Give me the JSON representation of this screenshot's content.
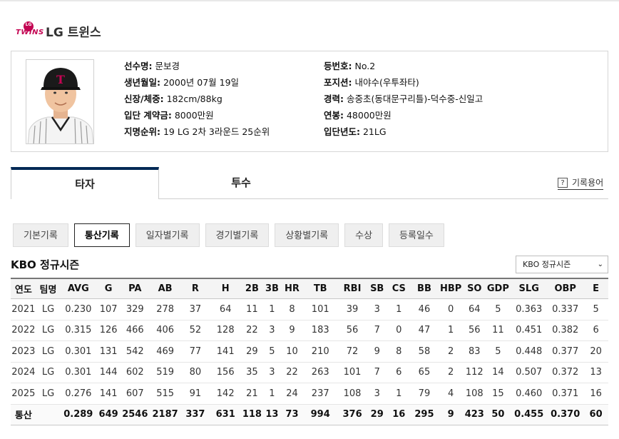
{
  "team": {
    "name": "LG 트윈스",
    "logo_text": "TWINS",
    "logo_mark": "LG"
  },
  "player": {
    "labels": {
      "name": "선수명:",
      "birth": "생년월일:",
      "body": "신장/체중:",
      "signing": "입단 계약금:",
      "draft": "지명순위:",
      "number": "등번호:",
      "position": "포지션:",
      "career": "경력:",
      "salary": "연봉:",
      "entry_year": "입단년도:"
    },
    "values": {
      "name": "문보경",
      "birth": "2000년 07월 19일",
      "body": "182cm/88kg",
      "signing": "8000만원",
      "draft": "19 LG 2차 3라운드 25순위",
      "number": "No.2",
      "position": "내야수(우투좌타)",
      "career": "송중초(동대문구리틀)-덕수중-신일고",
      "salary": "48000만원",
      "entry_year": "21LG"
    }
  },
  "tabs": [
    {
      "label": "타자",
      "active": true
    },
    {
      "label": "투수",
      "active": false
    }
  ],
  "glossary_label": "기록용어",
  "subtabs": [
    {
      "label": "기본기록",
      "active": false
    },
    {
      "label": "통산기록",
      "active": true
    },
    {
      "label": "일자별기록",
      "active": false
    },
    {
      "label": "경기별기록",
      "active": false
    },
    {
      "label": "상황별기록",
      "active": false
    },
    {
      "label": "수상",
      "active": false
    },
    {
      "label": "등록일수",
      "active": false
    }
  ],
  "section_title": "KBO 정규시즌",
  "season_select": "KBO 정규시즌",
  "stats": {
    "headers": [
      "연도",
      "팀명",
      "AVG",
      "G",
      "PA",
      "AB",
      "R",
      "H",
      "2B",
      "3B",
      "HR",
      "TB",
      "RBI",
      "SB",
      "CS",
      "BB",
      "HBP",
      "SO",
      "GDP",
      "SLG",
      "OBP",
      "E"
    ],
    "rows": [
      [
        "2021",
        "LG",
        "0.230",
        "107",
        "329",
        "278",
        "37",
        "64",
        "11",
        "1",
        "8",
        "101",
        "39",
        "3",
        "1",
        "46",
        "0",
        "64",
        "5",
        "0.363",
        "0.337",
        "5"
      ],
      [
        "2022",
        "LG",
        "0.315",
        "126",
        "466",
        "406",
        "52",
        "128",
        "22",
        "3",
        "9",
        "183",
        "56",
        "7",
        "0",
        "47",
        "1",
        "56",
        "11",
        "0.451",
        "0.382",
        "6"
      ],
      [
        "2023",
        "LG",
        "0.301",
        "131",
        "542",
        "469",
        "77",
        "141",
        "29",
        "5",
        "10",
        "210",
        "72",
        "9",
        "8",
        "58",
        "2",
        "83",
        "5",
        "0.448",
        "0.377",
        "20"
      ],
      [
        "2024",
        "LG",
        "0.301",
        "144",
        "602",
        "519",
        "80",
        "156",
        "35",
        "3",
        "22",
        "263",
        "101",
        "7",
        "6",
        "65",
        "2",
        "112",
        "14",
        "0.507",
        "0.372",
        "13"
      ],
      [
        "2025",
        "LG",
        "0.276",
        "141",
        "607",
        "515",
        "91",
        "142",
        "21",
        "1",
        "24",
        "237",
        "108",
        "3",
        "1",
        "79",
        "4",
        "108",
        "15",
        "0.460",
        "0.371",
        "16"
      ]
    ],
    "total": [
      "통산",
      "",
      "0.289",
      "649",
      "2546",
      "2187",
      "337",
      "631",
      "118",
      "13",
      "73",
      "994",
      "376",
      "29",
      "16",
      "295",
      "9",
      "423",
      "50",
      "0.455",
      "0.370",
      "60"
    ]
  },
  "colors": {
    "brand": "#c30452",
    "navy": "#002955"
  }
}
